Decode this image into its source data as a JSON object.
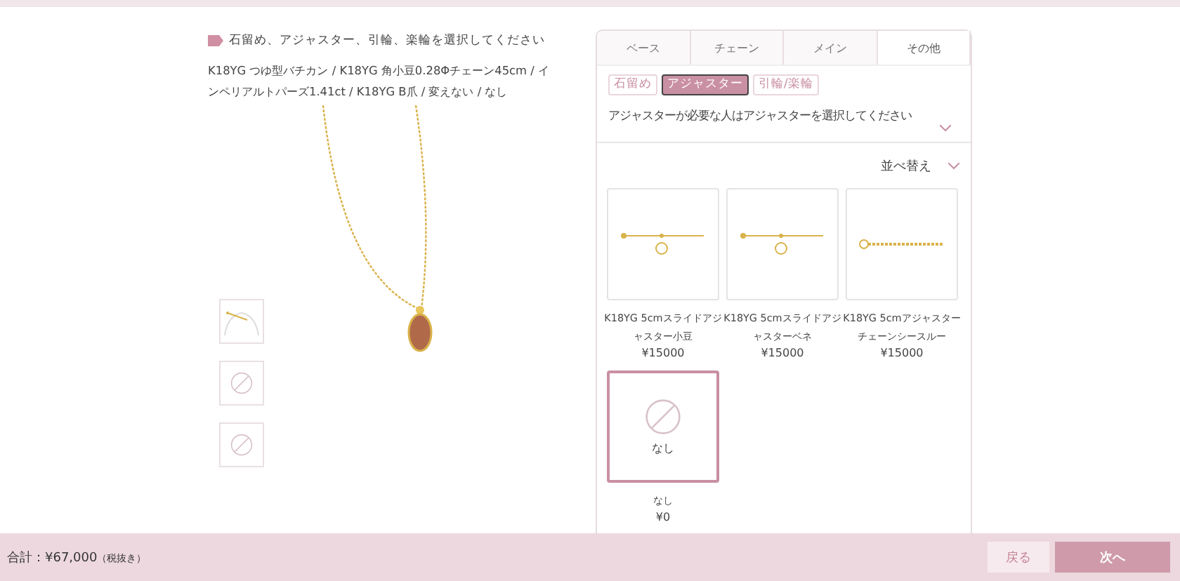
{
  "heading": "石留め、アジャスター、引輪、楽輪を選択してください",
  "summary": "K18YG つゆ型バチカン / K18YG 角小豆0.28Φチェーン45cm / インペリアルトパーズ1.41ct / K18YG B爪 / 変えない / なし",
  "thumbnails": [
    {
      "kind": "photo"
    },
    {
      "kind": "none"
    },
    {
      "kind": "none"
    }
  ],
  "steps": [
    {
      "label": "ベース",
      "selected": false
    },
    {
      "label": "チェーン",
      "selected": false
    },
    {
      "label": "メイン",
      "selected": false
    },
    {
      "label": "その他",
      "selected": true
    }
  ],
  "subtabs": [
    {
      "label": "石留め",
      "selected": false
    },
    {
      "label": "アジャスター",
      "selected": true
    },
    {
      "label": "引輪/楽輪",
      "selected": false
    }
  ],
  "instruction": "アジャスターが必要な人はアジャスターを選択してください",
  "sort": "並べ替え",
  "products": [
    {
      "kind": "slide",
      "name": "K18YG 5cmスライドアジャスター小豆",
      "price": "¥15000",
      "selected": false
    },
    {
      "kind": "slide",
      "name": "K18YG 5cmスライドアジャスターベネ",
      "price": "¥15000",
      "selected": false
    },
    {
      "kind": "chain",
      "name": "K18YG 5cmアジャスターチェーンシースルー",
      "price": "¥15000",
      "selected": false
    },
    {
      "kind": "none",
      "image_label": "なし",
      "name": "なし",
      "price": "¥0",
      "selected": true
    }
  ],
  "footer": {
    "total": "合計：¥67,000",
    "tax_note": "（税抜き）",
    "back": "戻る",
    "next": "次へ"
  }
}
